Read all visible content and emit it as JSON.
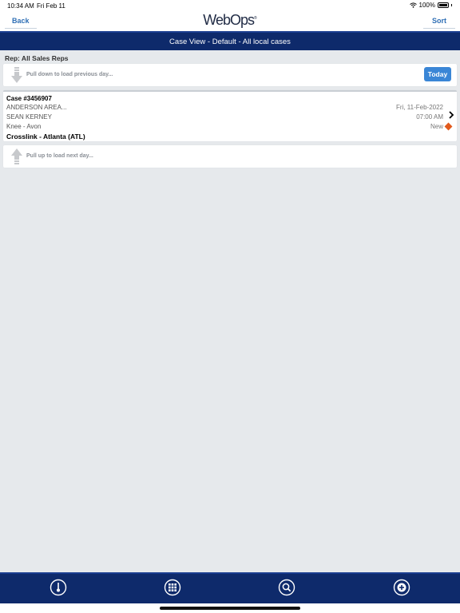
{
  "status_bar": {
    "time": "10:34 AM",
    "date": "Fri Feb 11",
    "battery": "100%"
  },
  "header": {
    "back_label": "Back",
    "sort_label": "Sort",
    "logo_text": "WebOps",
    "logo_mark": "®"
  },
  "title_bar": {
    "title": "Case View - Default - All local cases"
  },
  "rep_filter": {
    "label": "Rep: All Sales Reps"
  },
  "pull_previous": {
    "text": "Pull down to load previous day...",
    "today_label": "Today"
  },
  "case": {
    "number": "Case #3456907",
    "account": "ANDERSON AREA...",
    "surgeon": "SEAN KERNEY",
    "procedure": "Knee - Avon",
    "location": "Crosslink - Atlanta (ATL)",
    "date": "Fri, 11-Feb-2022",
    "time": "07:00 AM",
    "status": "New"
  },
  "pull_next": {
    "text": "Pull up to load next day..."
  },
  "colors": {
    "nav_bg": "#0e2a6b",
    "accent": "#3a86d6",
    "status_new": "#e25a1c"
  },
  "bottom_tabs": [
    "thermometer-icon",
    "grid-icon",
    "search-icon",
    "add-circle-icon"
  ]
}
